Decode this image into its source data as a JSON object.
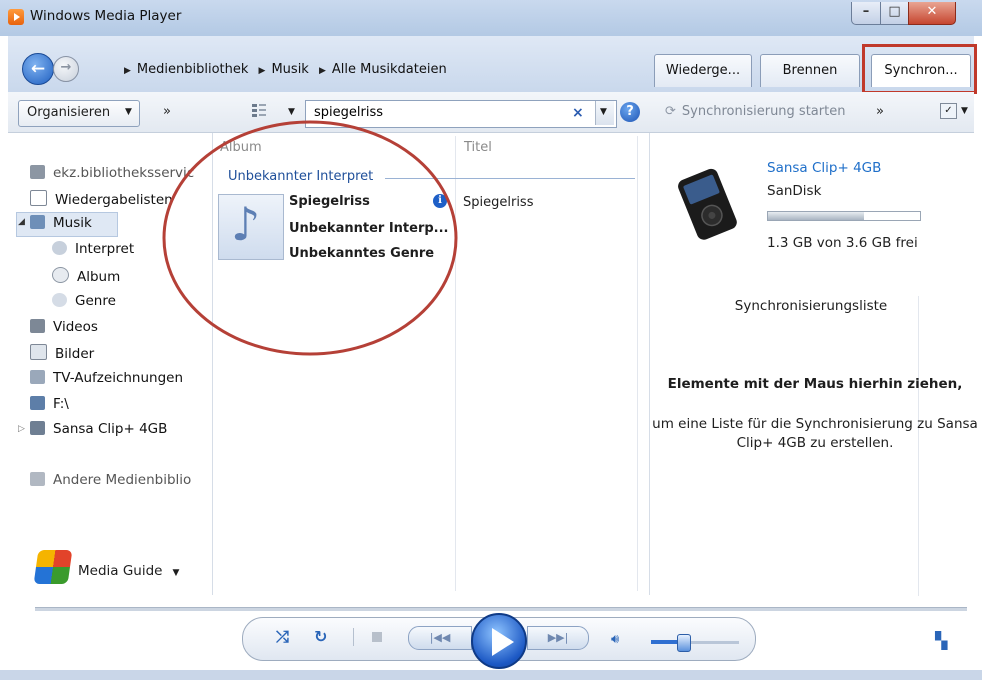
{
  "window": {
    "title": "Windows Media Player"
  },
  "nav": {
    "breadcrumb": [
      "Medienbibliothek",
      "Musik",
      "Alle Musikdateien"
    ],
    "tabs": [
      {
        "label": "Wiederge..."
      },
      {
        "label": "Brennen"
      },
      {
        "label": "Synchron..."
      }
    ]
  },
  "toolbar": {
    "organize_label": "Organisieren",
    "more_label": "»",
    "search_value": "spiegelriss",
    "search_clear": "×",
    "help": "?",
    "sync_start_label": "Synchronisierung starten",
    "more2_label": "»"
  },
  "sidebar": {
    "items": [
      {
        "label": "ekz.bibliotheksservic",
        "icon": "user-library-icon"
      },
      {
        "label": "Wiedergabelisten",
        "icon": "playlist-icon"
      },
      {
        "label": "Musik",
        "icon": "music-icon"
      },
      {
        "label": "Interpret",
        "icon": "artist-icon"
      },
      {
        "label": "Album",
        "icon": "album-icon"
      },
      {
        "label": "Genre",
        "icon": "genre-icon"
      },
      {
        "label": "Videos",
        "icon": "video-icon"
      },
      {
        "label": "Bilder",
        "icon": "picture-icon"
      },
      {
        "label": "TV-Aufzeichnungen",
        "icon": "tv-icon"
      },
      {
        "label": "F:\\",
        "icon": "drive-icon"
      },
      {
        "label": "Sansa Clip+ 4GB",
        "icon": "device-icon"
      },
      {
        "label": "Andere Medienbiblio",
        "icon": "other-libraries-icon"
      }
    ],
    "media_guide_label": "Media Guide"
  },
  "content": {
    "columns": [
      "Album",
      "Titel"
    ],
    "group_label": "Unbekannter Interpret",
    "album": {
      "name": "Spiegelriss",
      "artist": "Unbekannter Interp...",
      "genre": "Unbekanntes Genre"
    },
    "track_title": "Spiegelriss"
  },
  "sync_pane": {
    "device_name": "Sansa Clip+ 4GB",
    "device_brand": "SanDisk",
    "capacity_used_fraction": 0.63,
    "free_text": "1.3 GB von 3.6 GB frei",
    "list_title": "Synchronisierungsliste",
    "drag_title": "Elemente mit der Maus hierhin ziehen,",
    "drag_desc": "um eine Liste für die Synchronisierung zu Sansa Clip+ 4GB zu erstellen."
  },
  "playback": {
    "volume_fraction": 0.35
  },
  "colors": {
    "highlight": "#c0392b",
    "link_blue": "#1f6fc9",
    "group_blue": "#1f4f9a"
  }
}
